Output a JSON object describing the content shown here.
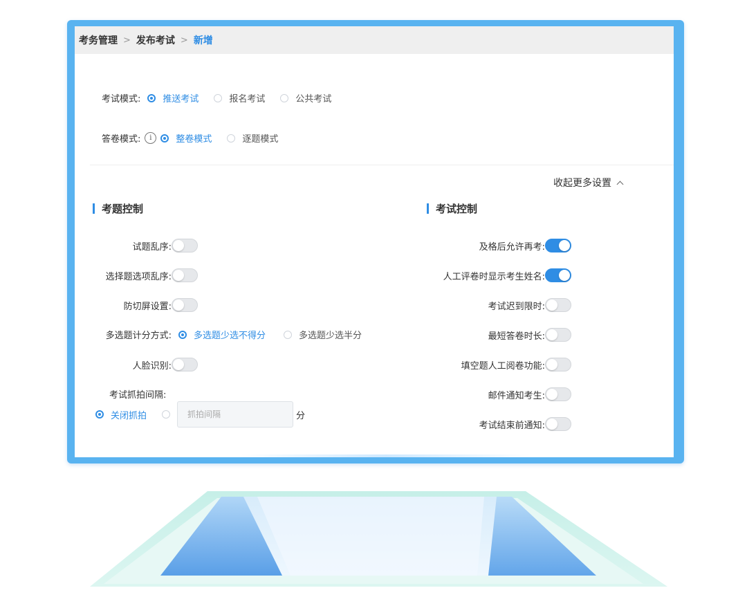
{
  "breadcrumb": {
    "items": [
      "考务管理",
      "发布考试",
      "新增"
    ],
    "separator": ">"
  },
  "exam_mode": {
    "label": "考试模式:",
    "options": [
      {
        "label": "推送考试",
        "checked": true
      },
      {
        "label": "报名考试",
        "checked": false
      },
      {
        "label": "公共考试",
        "checked": false
      }
    ]
  },
  "answer_mode": {
    "label": "答卷模式:",
    "info_icon": "info-circle-icon",
    "options": [
      {
        "label": "整卷模式",
        "checked": true
      },
      {
        "label": "逐题模式",
        "checked": false
      }
    ]
  },
  "collapse_more": {
    "label": "收起更多设置"
  },
  "question_control": {
    "title": "考题控制",
    "shuffle_questions": {
      "label": "试题乱序:",
      "on": false
    },
    "shuffle_options": {
      "label": "选择题选项乱序:",
      "on": false
    },
    "anti_switch": {
      "label": "防切屏设置:",
      "on": false
    },
    "multi_score": {
      "label": "多选题计分方式:",
      "options": [
        {
          "label": "多选题少选不得分",
          "checked": true
        },
        {
          "label": "多选题少选半分",
          "checked": false
        }
      ]
    },
    "face_recognition": {
      "label": "人脸识别:",
      "on": false
    },
    "capture_interval": {
      "label": "考试抓拍间隔:",
      "off_option": {
        "label": "关闭抓拍",
        "checked": true
      },
      "placeholder": "抓拍间隔",
      "unit": "分"
    }
  },
  "exam_control": {
    "title": "考试控制",
    "toggles": [
      {
        "label": "及格后允许再考:",
        "on": true
      },
      {
        "label": "人工评卷时显示考生姓名:",
        "on": true
      },
      {
        "label": "考试迟到限时:",
        "on": false
      },
      {
        "label": "最短答卷时长:",
        "on": false
      },
      {
        "label": "填空题人工阅卷功能:",
        "on": false
      },
      {
        "label": "邮件通知考生:",
        "on": false
      },
      {
        "label": "考试结束前通知:",
        "on": false
      }
    ]
  },
  "colors": {
    "accent": "#2f8de4",
    "frame": "#59b3f0",
    "crumb_bg": "#efefef",
    "toggle_off": "#e6e8eb",
    "stand_light": "#d7f3ef",
    "stand_blue": "#4f9ae6"
  }
}
